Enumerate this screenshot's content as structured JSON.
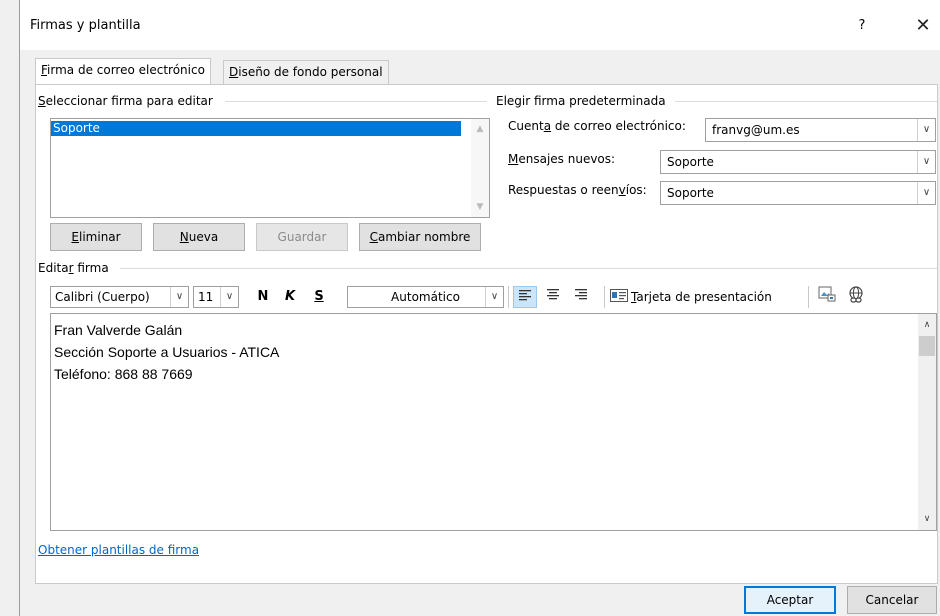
{
  "window": {
    "title": "Firmas y plantilla",
    "help": "?",
    "close": "✕"
  },
  "tabs": [
    {
      "label": "Firma de correo electrónico",
      "underline": "F",
      "rest": "irma de correo electrónico"
    },
    {
      "label": "Diseño de fondo personal",
      "underline": "D",
      "rest": "iseño de fondo personal"
    }
  ],
  "select_signature": {
    "label_u": "S",
    "label_rest": "eleccionar firma para editar",
    "items": [
      "Soporte"
    ]
  },
  "buttons": {
    "delete_u": "E",
    "delete_rest": "liminar",
    "new_u": "N",
    "new_rest": "ueva",
    "save": "Guardar",
    "rename_u": "C",
    "rename_rest": "ambiar nombre",
    "accept": "Aceptar",
    "cancel": "Cancelar"
  },
  "default_signature": {
    "label": "Elegir firma predeterminada",
    "account_label_a": "Cuent",
    "account_label_u": "a",
    "account_label_b": " de correo electrónico:",
    "account_value": "franvg@um.es",
    "new_messages_label_u": "M",
    "new_messages_label_rest": "ensajes nuevos:",
    "new_messages_value": "Soporte",
    "replies_label_a": "Respuestas o reen",
    "replies_label_u": "v",
    "replies_label_b": "íos:",
    "replies_value": "Soporte"
  },
  "edit_signature": {
    "label_a": "Edita",
    "label_u": "r",
    "label_b": " firma",
    "font": "Calibri (Cuerpo)",
    "size": "11",
    "bold": "N",
    "italic": "K",
    "underline": "S",
    "color": "Automático",
    "business_card_u": "T",
    "business_card_rest": "arjeta de presentación"
  },
  "signature_text": [
    "Fran Valverde Galán",
    "Sección Soporte a Usuarios - ATICA",
    "Teléfono: 868 88 7669"
  ],
  "templates_link": "Obtener plantillas de firma",
  "icons": {
    "align_left": "align-left-icon",
    "align_center": "align-center-icon",
    "align_right": "align-right-icon",
    "business_card": "business-card-icon",
    "picture": "insert-picture-icon",
    "hyperlink": "insert-hyperlink-icon"
  },
  "colors": {
    "selection": "#0078d7",
    "link": "#0066cc",
    "accent": "#0078d7"
  }
}
